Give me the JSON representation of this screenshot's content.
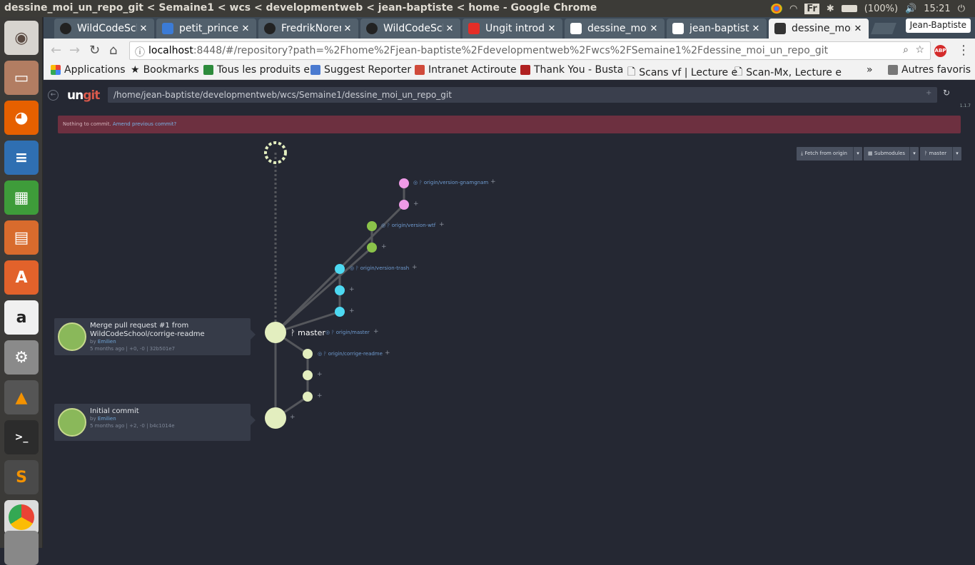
{
  "os": {
    "window_title": "dessine_moi_un_repo_git < Semaine1 < wcs < developmentweb < jean-baptiste < home - Google Chrome",
    "keyboard": "Fr",
    "battery": "(100%)",
    "clock": "15:21",
    "launcher": [
      "ubuntu-icon",
      "files-icon",
      "firefox-icon",
      "writer-icon",
      "calc-icon",
      "impress-icon",
      "software-center-icon",
      "amazon-icon",
      "settings-icon",
      "vlc-icon",
      "terminal-icon",
      "sublime-icon",
      "chrome-icon",
      "trash-icon"
    ]
  },
  "browser": {
    "profile": "Jean-Baptiste",
    "tabs": [
      {
        "label": "WildCodeSch",
        "icon": "github-icon"
      },
      {
        "label": "petit_prince",
        "icon": "p-icon"
      },
      {
        "label": "FredrikNoren",
        "icon": "github-icon"
      },
      {
        "label": "WildCodeSch",
        "icon": "github-icon"
      },
      {
        "label": "Ungit introdu",
        "icon": "youtube-icon"
      },
      {
        "label": "dessine_moi_",
        "icon": "ungit-icon"
      },
      {
        "label": "jean-baptiste",
        "icon": "ungit-icon"
      },
      {
        "label": "dessine_moi_",
        "icon": "ungit-icon"
      }
    ],
    "url_host": "localhost",
    "url_rest": ":8448/#/repository?path=%2Fhome%2Fjean-baptiste%2Fdevelopmentweb%2Fwcs%2FSemaine1%2Fdessine_moi_un_repo_git",
    "adblock": "ABP",
    "bookmarks": [
      "Applications",
      "Bookmarks",
      "Tous les produits e",
      "Suggest Reporter",
      "Intranet Actiroute",
      "Thank You - Busta",
      "Scans vf | Lecture e",
      "Scan-Mx, Lecture e"
    ],
    "bookmarks_more": "»",
    "bookmarks_other": "Autres favoris"
  },
  "ungit": {
    "logo_a": "un",
    "logo_b": "git",
    "path": "/home/jean-baptiste/developmentweb/wcs/Semaine1/dessine_moi_un_repo_git",
    "version": "1.1.7",
    "status_text": "Nothing to commit.",
    "status_link": "Amend previous commit?",
    "toolbar": {
      "fetch": "Fetch from origin",
      "submodules": "Submodules",
      "branch": "master"
    },
    "branch_master": "master",
    "refs": {
      "gnamgnam": "origin/version-gnamgnam",
      "wtf": "origin/version-wtf",
      "trash": "origin/version-trash",
      "master": "origin/master",
      "readme": "origin/corrige-readme"
    },
    "commits": [
      {
        "title": "Merge pull request #1 from WildCodeSchool/corrige-readme",
        "author": "Emilien",
        "by": "by",
        "meta": "5 months ago | +0, -0 | 32b501e7"
      },
      {
        "title": "Initial commit",
        "author": "Emilien",
        "by": "by",
        "meta": "5 months ago | +2, -0 | b4c1014e"
      }
    ],
    "colors": {
      "pink": "#ee9ae6",
      "green": "#8bc34a",
      "cyan": "#4dd9f2",
      "pale": "#e3eebf",
      "line": "#55575c"
    }
  }
}
